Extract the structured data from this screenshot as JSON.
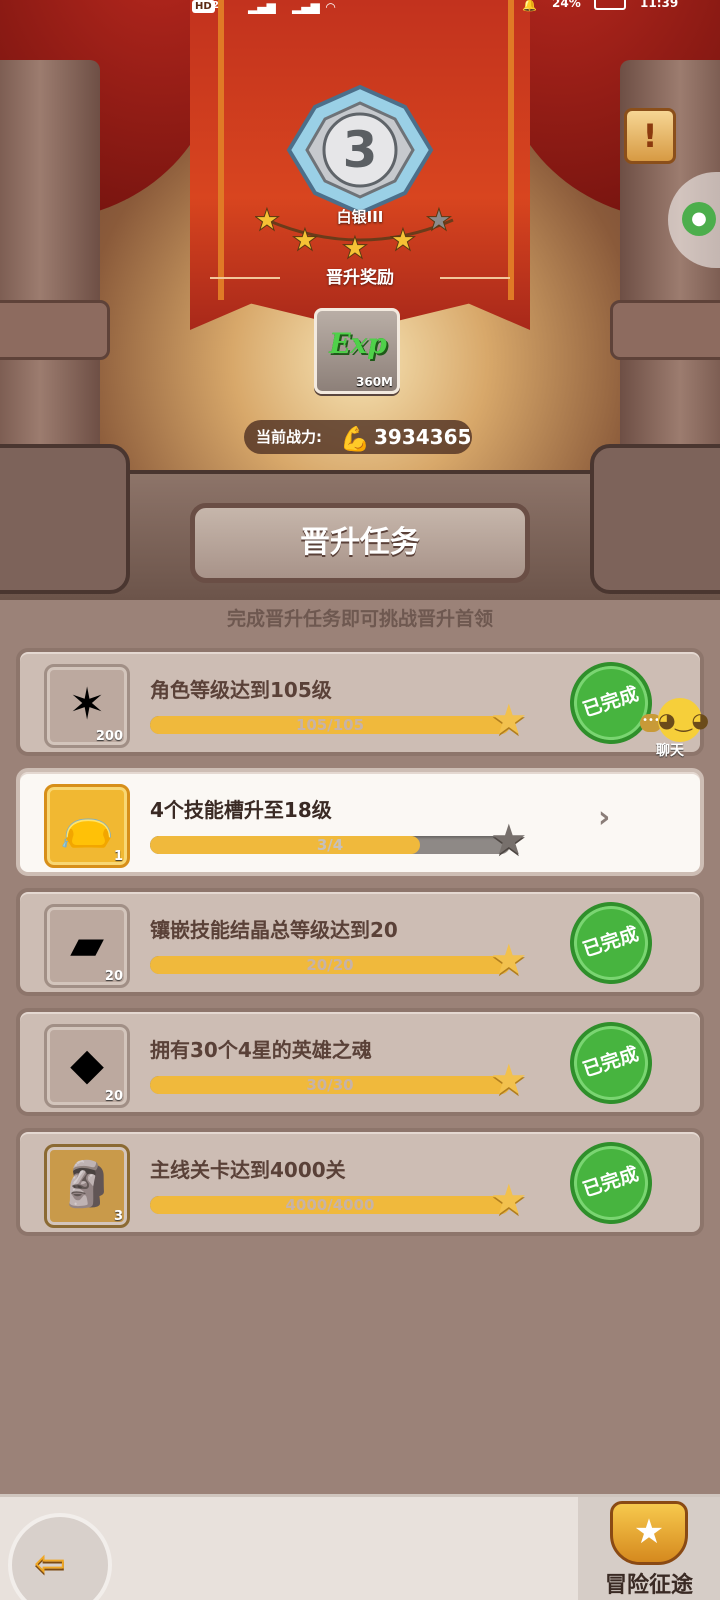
{
  "status_bar": {
    "hd": "HD",
    "sim": "2",
    "battery": "24%",
    "time": "11:39"
  },
  "rank": {
    "number": "3",
    "name": "白银III",
    "stars_filled": 4,
    "stars_total": 5
  },
  "reward": {
    "title": "晋升奖励",
    "exp_icon": "Exp",
    "exp_amount": "360M"
  },
  "power": {
    "label": "当前战力:",
    "value": "3934365"
  },
  "section_title": "晋升任务",
  "subtitle": "完成晋升任务即可挑战晋升首领",
  "done_label": "已完成",
  "tasks": [
    {
      "label": "角色等级达到105级",
      "progress_text": "105/105",
      "progress": 1.0,
      "item_qty": "200",
      "completed": true,
      "icon": "starfish-icon"
    },
    {
      "label": "4个技能槽升至18级",
      "progress_text": "3/4",
      "progress": 0.75,
      "item_qty": "1",
      "completed": false,
      "icon": "skill-bag-icon"
    },
    {
      "label": "镶嵌技能结晶总等级达到20",
      "progress_text": "20/20",
      "progress": 1.0,
      "item_qty": "20",
      "completed": true,
      "icon": "crystal-card-icon"
    },
    {
      "label": "拥有30个4星的英雄之魂",
      "progress_text": "30/30",
      "progress": 1.0,
      "item_qty": "20",
      "completed": true,
      "icon": "soul-shard-icon"
    },
    {
      "label": "主线关卡达到4000关",
      "progress_text": "4000/4000",
      "progress": 1.0,
      "item_qty": "3",
      "completed": true,
      "icon": "stone-golem-icon"
    }
  ],
  "chat": {
    "label": "聊天"
  },
  "bottom": {
    "adventure_label": "冒险征途"
  },
  "colors": {
    "accent_gold": "#f0b93c",
    "done_green": "#47b43f",
    "banner_red": "#c2321e"
  }
}
